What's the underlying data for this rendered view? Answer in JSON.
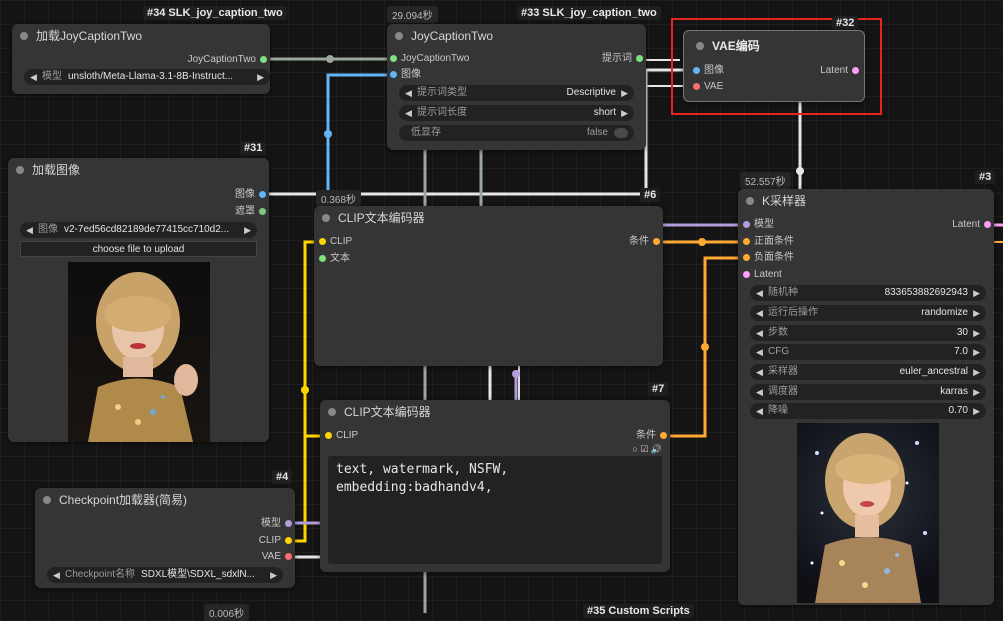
{
  "colors": {
    "image": "#64b5f6",
    "string": "#7ee07e",
    "clip": "#ffd500",
    "conditioning": "#ffa931",
    "model": "#b39ddb",
    "vae": "#ff6e6e",
    "latent": "#ff9cf9",
    "mask": "#81c784",
    "highlight": "#e8231f"
  },
  "group_labels": {
    "top_left": "#34 SLK_joy_caption_two",
    "top_mid": "#33 SLK_joy_caption_two",
    "bottom": "#35 Custom Scripts"
  },
  "timings": {
    "joycaption": "29.094秒",
    "clip6": "0.368秒",
    "ksampler": "52.557秒",
    "bottom": "0.006秒"
  },
  "nodes": {
    "load_joycaption": {
      "title": "加载JoyCaptionTwo",
      "outputs": [
        "JoyCaptionTwo"
      ],
      "widget": {
        "label": "模型",
        "value": "unsloth/Meta-Llama-3.1-8B-Instruct..."
      }
    },
    "joycaption": {
      "title": "JoyCaptionTwo",
      "inputs": [
        "JoyCaptionTwo",
        "图像"
      ],
      "outputs": [
        "提示词"
      ],
      "widgets": [
        {
          "label": "提示词类型",
          "value": "Descriptive"
        },
        {
          "label": "提示词长度",
          "value": "short"
        }
      ],
      "toggle": {
        "label": "低显存",
        "value": "false"
      }
    },
    "vae_encode": {
      "id": "#32",
      "title": "VAE编码",
      "inputs": [
        "图像",
        "VAE"
      ],
      "outputs": [
        "Latent"
      ]
    },
    "load_image": {
      "id": "#31",
      "title": "加载图像",
      "outputs": [
        "图像",
        "遮罩"
      ],
      "widget": {
        "label": "图像",
        "value": "v2-7ed56cd82189de77415cc710d2..."
      },
      "button": "choose file to upload"
    },
    "clip_encode_pos": {
      "id": "#6",
      "title": "CLIP文本编码器",
      "inputs": [
        "CLIP",
        "文本"
      ],
      "outputs": [
        "条件"
      ]
    },
    "clip_encode_neg": {
      "id": "#7",
      "title": "CLIP文本编码器",
      "inputs": [
        "CLIP"
      ],
      "outputs": [
        "条件"
      ],
      "text": "text, watermark, NSFW,\nembedding:badhandv4,"
    },
    "checkpoint": {
      "id": "#4",
      "title": "Checkpoint加载器(简易)",
      "outputs": [
        "模型",
        "CLIP",
        "VAE"
      ],
      "widget": {
        "label": "Checkpoint名称",
        "value": "SDXL模型\\SDXL_sdxlN..."
      }
    },
    "ksampler": {
      "id": "#3",
      "title": "K采样器",
      "inputs": [
        "模型",
        "正面条件",
        "负面条件",
        "Latent"
      ],
      "outputs": [
        "Latent"
      ],
      "widgets": [
        {
          "label": "随机种",
          "value": "833653882692943"
        },
        {
          "label": "运行后操作",
          "value": "randomize"
        },
        {
          "label": "步数",
          "value": "30"
        },
        {
          "label": "CFG",
          "value": "7.0"
        },
        {
          "label": "采样器",
          "value": "euler_ancestral"
        },
        {
          "label": "调度器",
          "value": "karras"
        },
        {
          "label": "降噪",
          "value": "0.70"
        }
      ]
    }
  }
}
